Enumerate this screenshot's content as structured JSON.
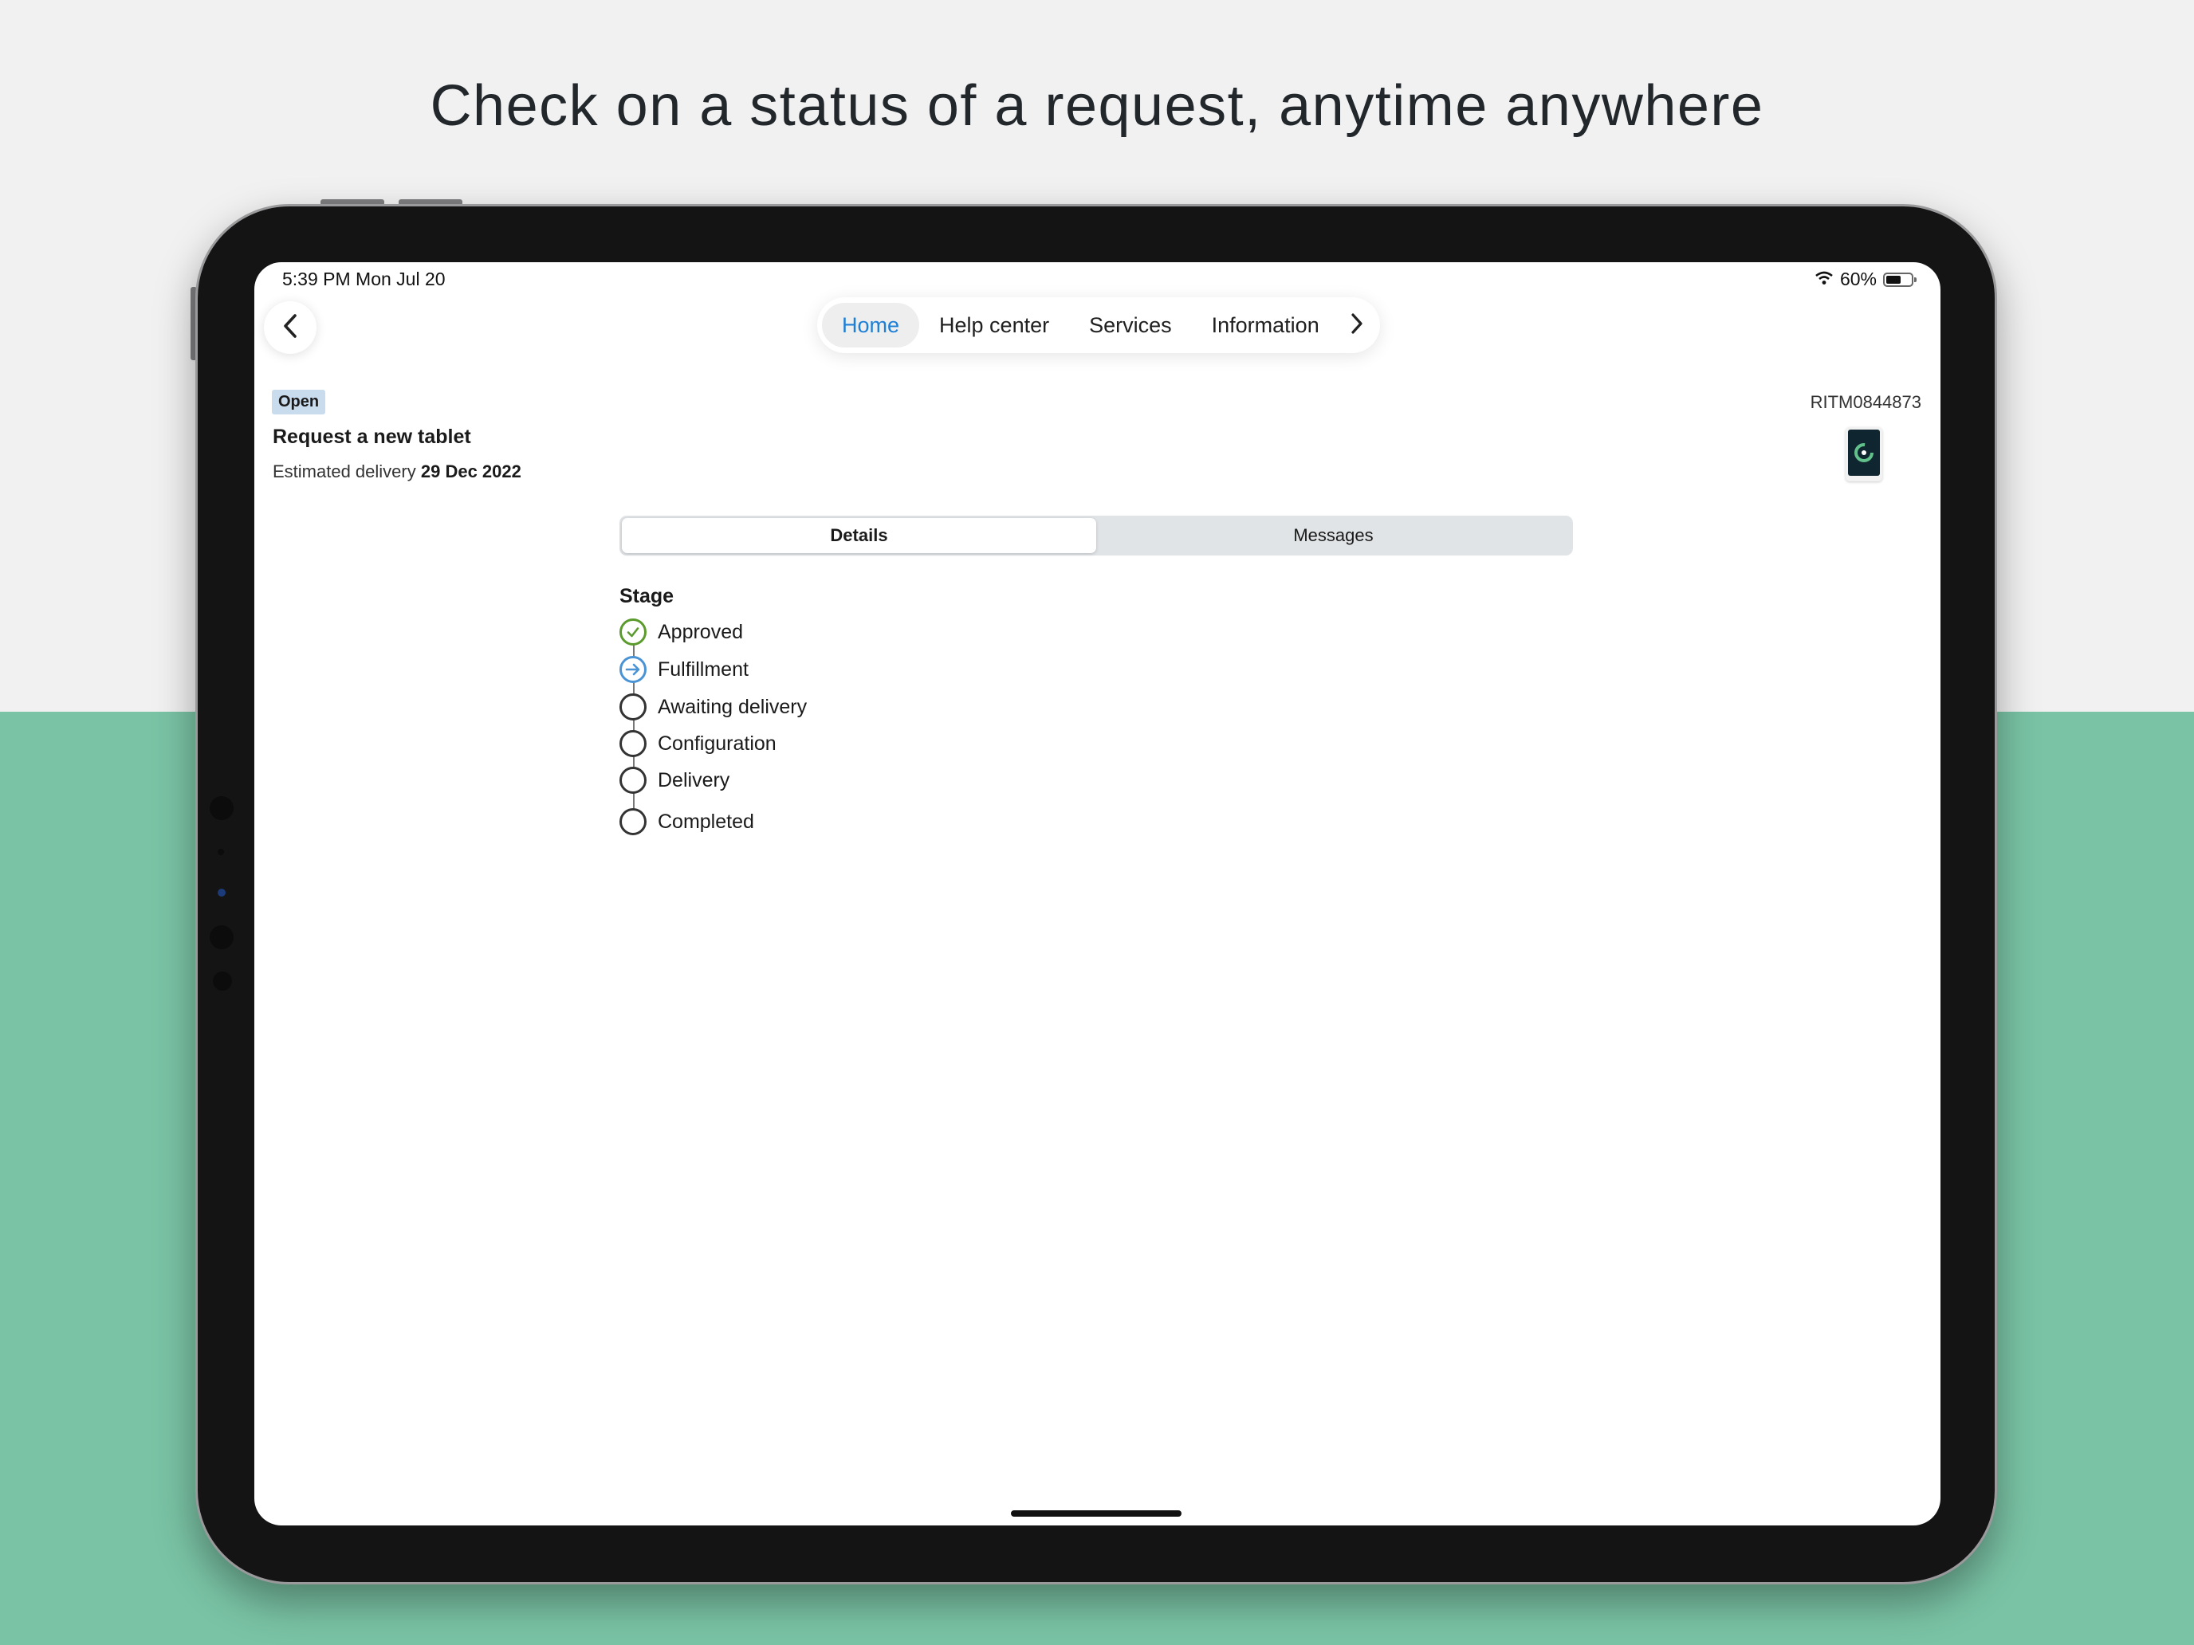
{
  "headline": "Check on a status of a request, anytime anywhere",
  "status_bar": {
    "time": "5:39 PM   Mon Jul 20",
    "battery_text": "60%",
    "battery_level": 0.6
  },
  "nav": {
    "tabs": [
      {
        "label": "Home",
        "active": true
      },
      {
        "label": "Help center",
        "active": false
      },
      {
        "label": "Services",
        "active": false
      },
      {
        "label": "Information",
        "active": false
      }
    ],
    "back_icon": "chevron-left-icon",
    "next_icon": "chevron-right-icon"
  },
  "request": {
    "status": "Open",
    "title": "Request a new tablet",
    "estimated_label": "Estimated delivery",
    "estimated_date": "29 Dec 2022",
    "number": "RITM0844873"
  },
  "segments": [
    {
      "label": "Details",
      "active": true
    },
    {
      "label": "Messages",
      "active": false
    }
  ],
  "stage": {
    "title": "Stage",
    "items": [
      {
        "label": "Approved",
        "state": "done"
      },
      {
        "label": "Fulfillment",
        "state": "active"
      },
      {
        "label": "Awaiting delivery",
        "state": "pending"
      },
      {
        "label": "Configuration",
        "state": "pending"
      },
      {
        "label": "Delivery",
        "state": "pending"
      },
      {
        "label": "Completed",
        "state": "pending"
      }
    ]
  },
  "colors": {
    "accent": "#1e7fd6",
    "done": "#5b9a2c",
    "active": "#4a94d6",
    "background_band": "#7ac3a5",
    "badge": "#c9dcee"
  }
}
